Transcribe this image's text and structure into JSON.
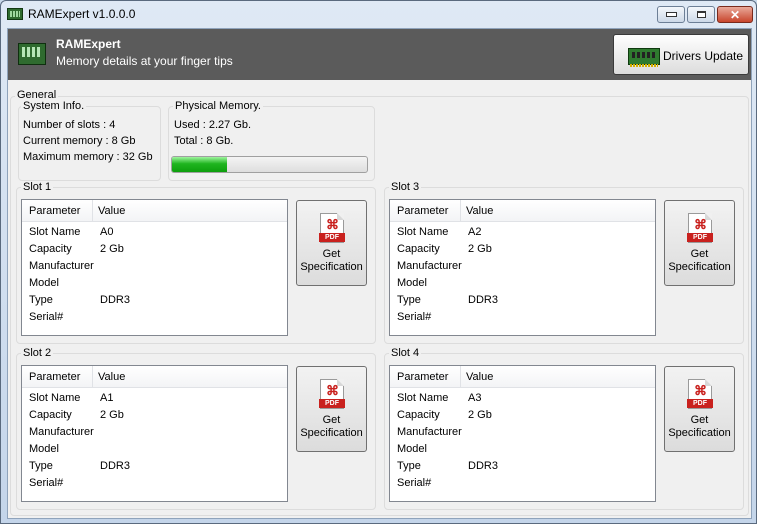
{
  "window": {
    "title": "RAMExpert v1.0.0.0",
    "controls": {
      "minimize": "minimize",
      "maximize": "maximize",
      "close": "✕"
    }
  },
  "header": {
    "title": "RAMExpert",
    "subtitle": "Memory details at your finger tips",
    "drivers_button": "Drivers Update",
    "background": "#5b5b5b"
  },
  "general": {
    "label": "General",
    "system_info": {
      "label": "System Info.",
      "lines": [
        "Number of slots : 4",
        "Current memory : 8 Gb",
        "Maximum memory : 32 Gb"
      ]
    },
    "physical_memory": {
      "label": "Physical Memory.",
      "used": "Used : 2.27 Gb.",
      "total": "Total : 8 Gb.",
      "usage_fraction": 0.284,
      "bar_color": "#1fb51f"
    }
  },
  "columns": {
    "parameter": "Parameter",
    "value": "Value"
  },
  "spec_button": {
    "line1": "Get",
    "line2": "Specification",
    "icon_text": "PDF"
  },
  "slots": [
    {
      "label": "Slot 1",
      "rows": [
        {
          "k": "Slot Name",
          "v": "A0"
        },
        {
          "k": "Capacity",
          "v": "2 Gb"
        },
        {
          "k": "Manufacturer",
          "v": ""
        },
        {
          "k": "Model",
          "v": ""
        },
        {
          "k": "Type",
          "v": "DDR3"
        },
        {
          "k": "Serial#",
          "v": ""
        }
      ]
    },
    {
      "label": "Slot 2",
      "rows": [
        {
          "k": "Slot Name",
          "v": "A1"
        },
        {
          "k": "Capacity",
          "v": "2 Gb"
        },
        {
          "k": "Manufacturer",
          "v": ""
        },
        {
          "k": "Model",
          "v": ""
        },
        {
          "k": "Type",
          "v": "DDR3"
        },
        {
          "k": "Serial#",
          "v": ""
        }
      ]
    },
    {
      "label": "Slot 3",
      "rows": [
        {
          "k": "Slot Name",
          "v": "A2"
        },
        {
          "k": "Capacity",
          "v": "2 Gb"
        },
        {
          "k": "Manufacturer",
          "v": ""
        },
        {
          "k": "Model",
          "v": ""
        },
        {
          "k": "Type",
          "v": "DDR3"
        },
        {
          "k": "Serial#",
          "v": ""
        }
      ]
    },
    {
      "label": "Slot 4",
      "rows": [
        {
          "k": "Slot Name",
          "v": "A3"
        },
        {
          "k": "Capacity",
          "v": "2 Gb"
        },
        {
          "k": "Manufacturer",
          "v": ""
        },
        {
          "k": "Model",
          "v": ""
        },
        {
          "k": "Type",
          "v": "DDR3"
        },
        {
          "k": "Serial#",
          "v": ""
        }
      ]
    }
  ]
}
